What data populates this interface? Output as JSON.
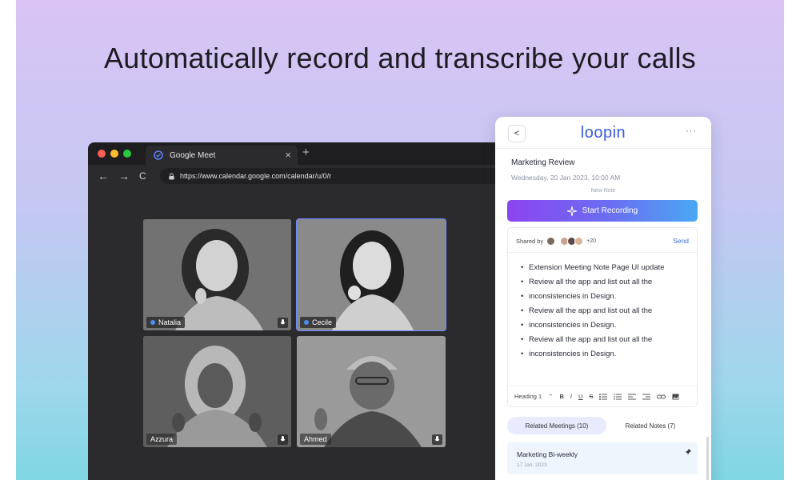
{
  "headline": "Automatically record and transcribe your calls",
  "browser": {
    "tab_title": "Google Meet",
    "tab_close": "×",
    "new_tab": "+",
    "url": "https://www.calendar.google.com/calendar/u/0/r",
    "nav": {
      "back": "←",
      "forward": "→",
      "reload": "C"
    }
  },
  "participants": [
    {
      "name": "Natalia",
      "active": false
    },
    {
      "name": "Cecile",
      "active": true
    },
    {
      "name": "Azzura",
      "active": false
    },
    {
      "name": "Ahmed",
      "active": false
    }
  ],
  "panel": {
    "back_label": "<",
    "brand": "loopin",
    "more": "···",
    "meeting_title": "Marketing Review",
    "meeting_date": "Wednesday, 20 Jan 2023, 10:00 AM",
    "new_note": "New Note",
    "record_label": "Start Recording",
    "shared_by": "Shared by",
    "shared_extra": "+20",
    "send_label": "Send",
    "bullets": [
      "Extension Meeting Note Page UI update",
      "Review all the app and list out all the",
      "inconsistencies in Design.",
      "Review all the app and list out all the",
      "inconsistencies in Design.",
      "Review all the app and list out all the",
      "inconsistencies in Design."
    ],
    "toolbar": {
      "heading": "Heading 1",
      "caret": "⌃",
      "bold": "B",
      "italic": "I",
      "underline": "U",
      "strike": "S"
    },
    "related_meetings": "Related Meetings (10)",
    "related_notes": "Related Notes (7)",
    "card_title": "Marketing Bi-weekly",
    "card_date": "17 Jan, 2023"
  },
  "colors": {
    "accent": "#3b5bdb",
    "record_start": "#8b44f0",
    "record_end": "#4aa8f3"
  }
}
